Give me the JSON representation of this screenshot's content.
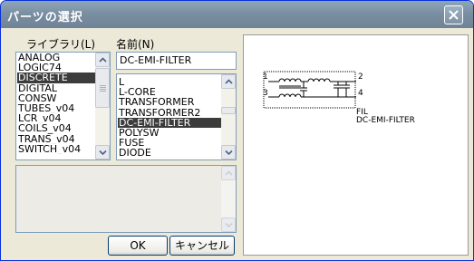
{
  "window": {
    "title": "パーツの選択"
  },
  "library": {
    "label": "ライブラリ(L)",
    "items": [
      "ANALOG",
      "LOGIC74",
      "DISCRETE",
      "DIGITAL",
      "CONSW",
      "TUBES_v04",
      "LCR_v04",
      "COILS_v04",
      "TRANS_v04",
      "SWITCH_v04"
    ],
    "selected_index": 2
  },
  "name": {
    "label": "名前(N)",
    "value": "DC-EMI-FILTER",
    "items": [
      "L",
      "L-CORE",
      "TRANSFORMER",
      "TRANSFORMER2",
      "DC-EMI-FILTER",
      "POLYSW",
      "FUSE",
      "DIODE"
    ],
    "selected_index": 4
  },
  "buttons": {
    "ok": "OK",
    "cancel": "キャンセル"
  },
  "preview": {
    "part_type": "FIL",
    "part_name": "DC-EMI-FILTER",
    "pins": [
      "1",
      "2",
      "3",
      "4"
    ]
  }
}
